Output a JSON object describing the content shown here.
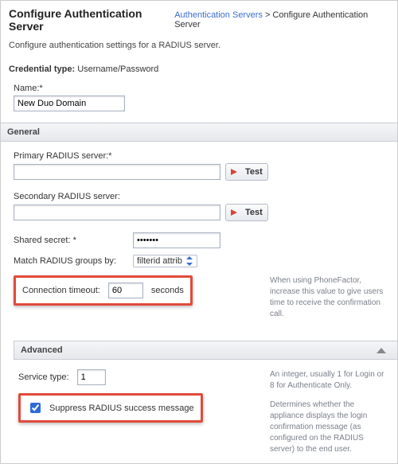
{
  "header": {
    "title": "Configure Authentication Server",
    "breadcrumb_link": "Authentication Servers",
    "breadcrumb_current": "Configure Authentication Server"
  },
  "intro": "Configure authentication settings for a RADIUS server.",
  "credential": {
    "label": "Credential type:",
    "value": "Username/Password"
  },
  "name": {
    "label": "Name:*",
    "value": "New Duo Domain"
  },
  "sections": {
    "general": "General",
    "advanced": "Advanced"
  },
  "general": {
    "primary_label": "Primary RADIUS server:*",
    "primary_value": "",
    "secondary_label": "Secondary RADIUS server:",
    "secondary_value": "",
    "test_label": "Test",
    "shared_secret_label": "Shared secret: *",
    "shared_secret_value": "•••••••",
    "match_label": "Match RADIUS groups by:",
    "match_value": "filterid attrib",
    "timeout_label": "Connection timeout:",
    "timeout_value": "60",
    "timeout_unit": "seconds",
    "timeout_help": "When using PhoneFactor, increase this value to give users time to receive the confirmation call."
  },
  "advanced": {
    "service_label": "Service type:",
    "service_value": "1",
    "service_help": "An integer, usually 1 for Login or 8 for Authenticate Only.",
    "suppress_label": "Suppress RADIUS success message",
    "suppress_checked": true,
    "suppress_help": "Determines whether the appliance displays the login confirmation message (as configured on the RADIUS server) to the end user."
  }
}
